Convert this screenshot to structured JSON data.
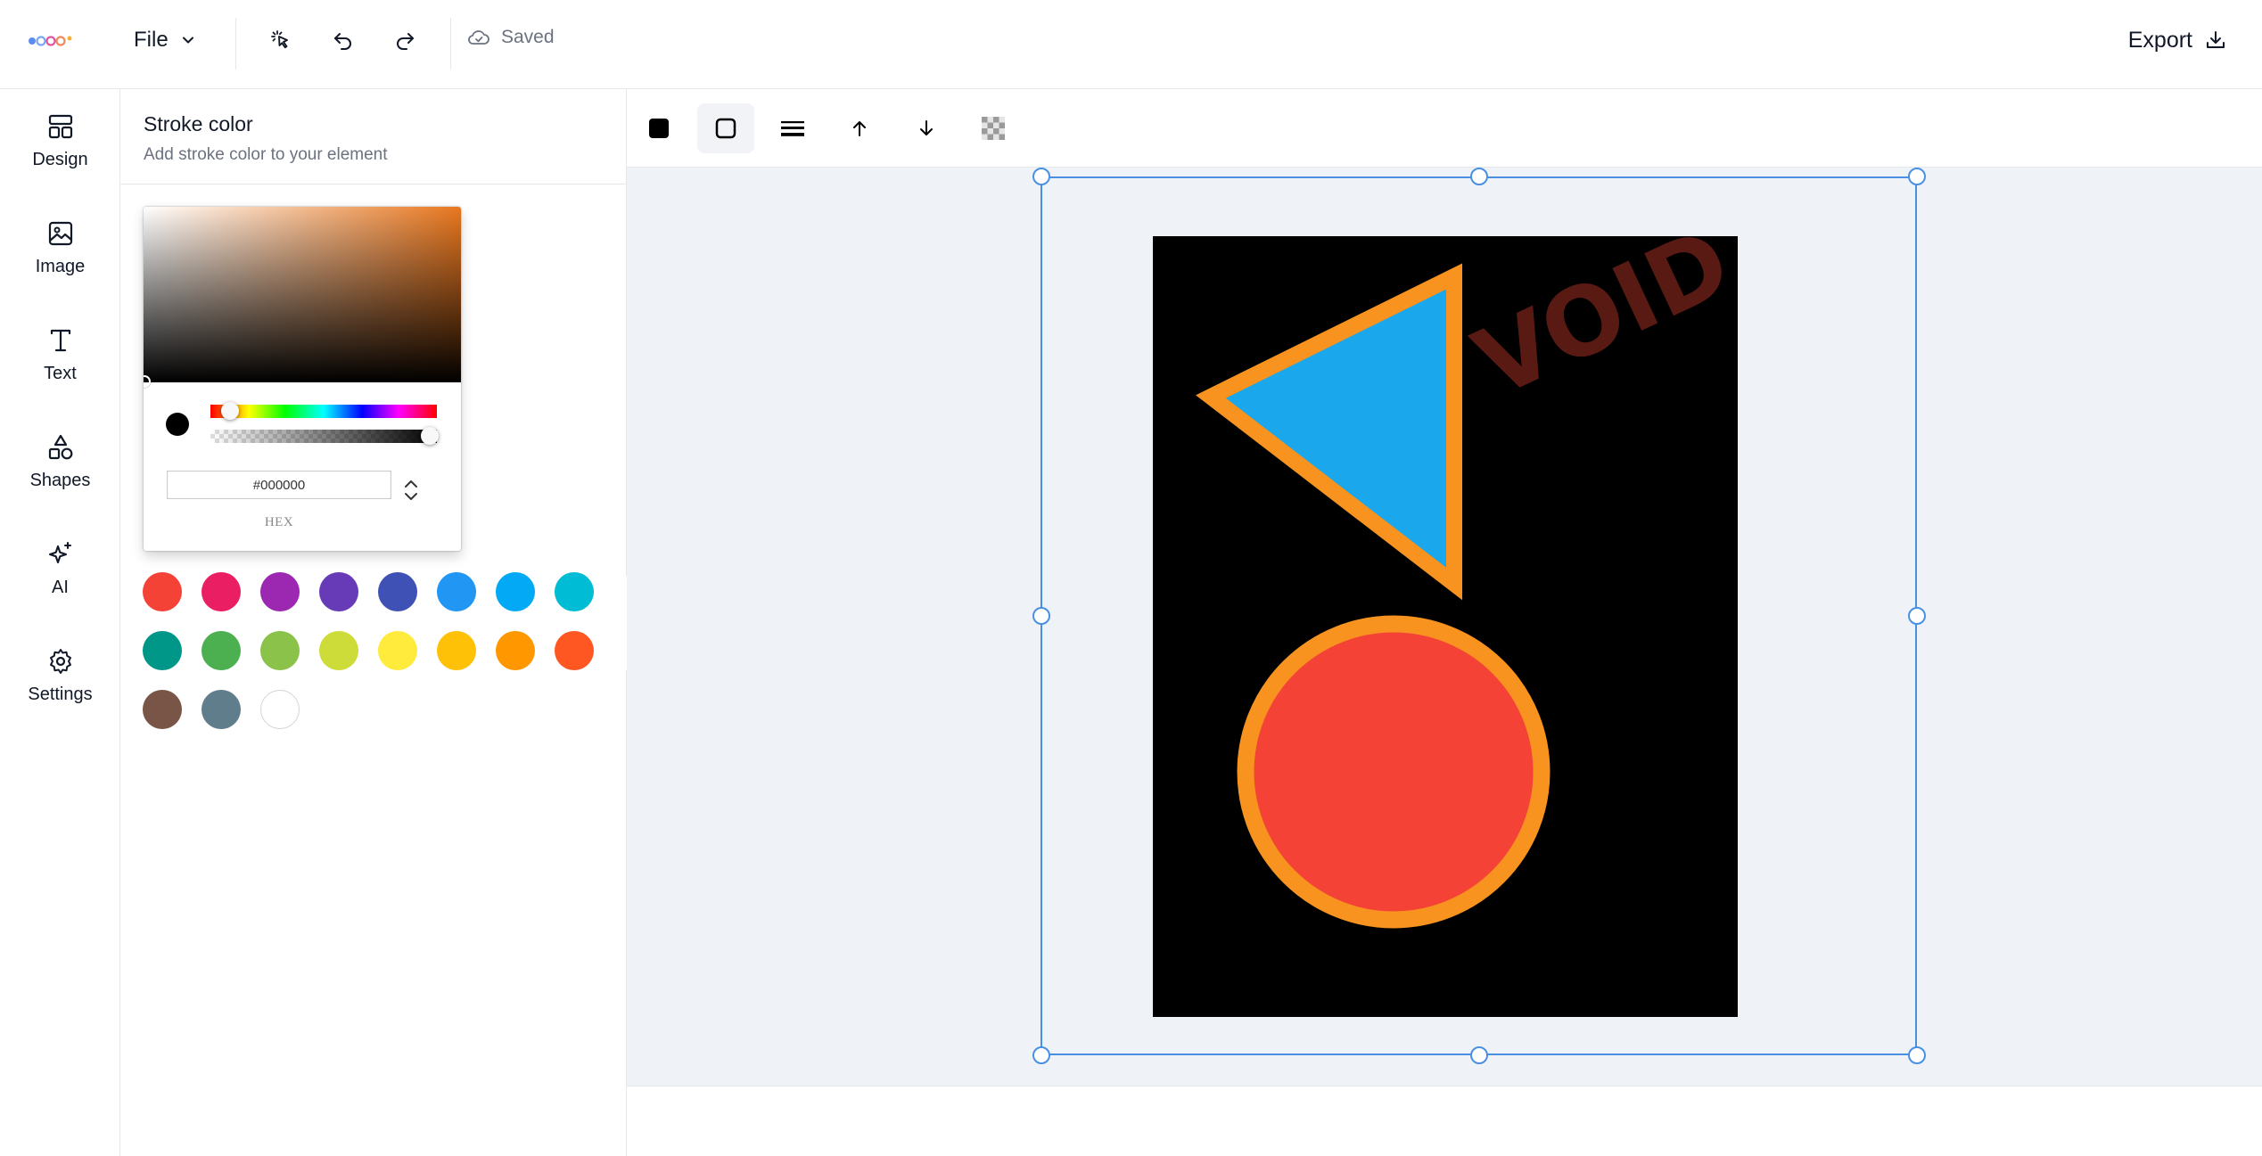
{
  "header": {
    "file_label": "File",
    "saved_label": "Saved",
    "export_label": "Export"
  },
  "sidebar": {
    "items": [
      {
        "label": "Design",
        "icon": "layout-icon"
      },
      {
        "label": "Image",
        "icon": "image-icon"
      },
      {
        "label": "Text",
        "icon": "text-icon"
      },
      {
        "label": "Shapes",
        "icon": "shapes-icon"
      },
      {
        "label": "AI",
        "icon": "sparkles-icon"
      },
      {
        "label": "Settings",
        "icon": "gear-icon"
      }
    ]
  },
  "panel": {
    "title": "Stroke color",
    "subtitle": "Add stroke color to your element",
    "picker": {
      "hex_value": "#000000",
      "format_label": "HEX",
      "base_hue_color": "#e8771f",
      "hue_position": 0.08,
      "alpha": 1.0
    },
    "swatches": [
      "#f44336",
      "#e91e63",
      "#9c27b0",
      "#673ab7",
      "#3f51b5",
      "#2196f3",
      "#03a9f4",
      "#00bcd4",
      "#009688",
      "#4caf50",
      "#8bc34a",
      "#cddc39",
      "#ffeb3b",
      "#ffc107",
      "#ff9800",
      "#ff5722",
      "#795548",
      "#607d8b",
      "#ffffff"
    ]
  },
  "canvas": {
    "background_color": "#000000",
    "watermark_text": "VOID",
    "watermark_color": "#5a1a14",
    "triangle": {
      "fill": "#1aa7ec",
      "stroke": "#f7931e"
    },
    "circle": {
      "fill": "#f44336",
      "stroke": "#f7931e"
    },
    "selection_color": "#4a90e2"
  }
}
